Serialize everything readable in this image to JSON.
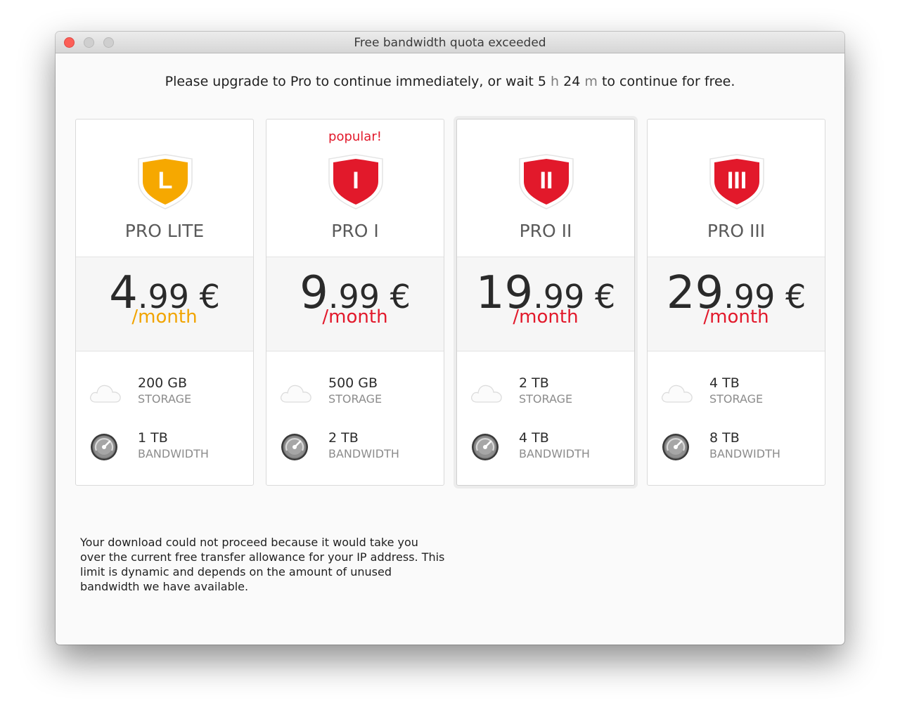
{
  "window": {
    "title": "Free bandwidth quota exceeded"
  },
  "notice": {
    "prefix": "Please upgrade to Pro to continue immediately, or wait 5",
    "hours_unit": "h",
    "minutes_value": "24",
    "minutes_unit": "m",
    "suffix": "to continue for free."
  },
  "plans": [
    {
      "name": "PRO LITE",
      "badge": "",
      "shield_letter": "L",
      "shield_color": "#f6a800",
      "price_int": "4",
      "price_dec": ".99 €",
      "period": "/month",
      "period_color": "#f1a400",
      "storage_value": "200 GB",
      "storage_label": "STORAGE",
      "bandwidth_value": "1 TB",
      "bandwidth_label": "BANDWIDTH"
    },
    {
      "name": "PRO I",
      "badge": "popular!",
      "shield_letter": "I",
      "shield_color": "#e2192b",
      "price_int": "9",
      "price_dec": ".99 €",
      "period": "/month",
      "period_color": "#e2192b",
      "storage_value": "500 GB",
      "storage_label": "STORAGE",
      "bandwidth_value": "2 TB",
      "bandwidth_label": "BANDWIDTH"
    },
    {
      "name": "PRO II",
      "badge": "",
      "shield_letter": "II",
      "shield_color": "#e2192b",
      "price_int": "19",
      "price_dec": ".99 €",
      "period": "/month",
      "period_color": "#e2192b",
      "storage_value": "2 TB",
      "storage_label": "STORAGE",
      "bandwidth_value": "4 TB",
      "bandwidth_label": "BANDWIDTH"
    },
    {
      "name": "PRO III",
      "badge": "",
      "shield_letter": "III",
      "shield_color": "#e2192b",
      "price_int": "29",
      "price_dec": ".99 €",
      "period": "/month",
      "period_color": "#e2192b",
      "storage_value": "4 TB",
      "storage_label": "STORAGE",
      "bandwidth_value": "8 TB",
      "bandwidth_label": "BANDWIDTH"
    }
  ],
  "icons": {
    "storage": "cloud-icon",
    "bandwidth": "speedometer-icon"
  },
  "description": "Your download could not proceed because it would take you over the current free transfer allowance for your IP address. This limit is dynamic and depends on the amount of unused bandwidth we have available."
}
